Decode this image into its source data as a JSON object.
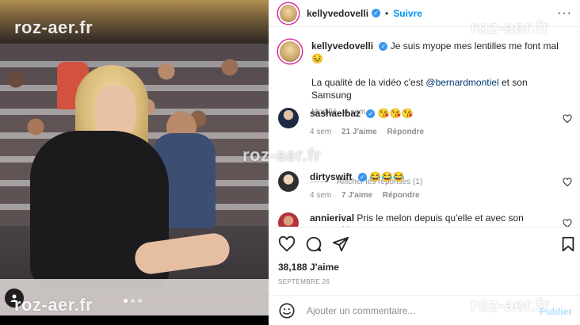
{
  "post": {
    "username": "kellyvedovelli",
    "follow_label": "Suivre",
    "separator": "•",
    "more_label": "···"
  },
  "caption": {
    "username": "kellyvedovelli",
    "line1": "Je suis myope mes lentilles me font mal 😣",
    "line2_prefix": "La qualité de la vidéo c'est ",
    "line2_mention": "@bernardmontiel",
    "line2_suffix": " et son Samsung",
    "meta": "Modifié · 4 sem"
  },
  "comments": [
    {
      "username": "sashaelbaz",
      "text": "😘😘😘",
      "time": "4 sem",
      "likes": "21 J'aime",
      "reply": "Répondre"
    },
    {
      "username": "dirtyswift",
      "text": "😂😂😂",
      "time": "4 sem",
      "likes": "7 J'aime",
      "reply": "Répondre"
    },
    {
      "username": "annierival",
      "text": "Pris le melon depuis qu'elle et avec son patron. Une"
    }
  ],
  "view_replies": "Afficher les réponses (1)",
  "likes": "38,188 J'aime",
  "date": "SEPTEMBRE 26",
  "add_comment": {
    "placeholder": "Ajouter un commentaire...",
    "publish": "Publier"
  },
  "watermarks": [
    "roz-aer.fr",
    "roz-aer.fr",
    "roz-aer.fr",
    "roz-aer.fr",
    "roz-aer.fr"
  ],
  "colors": {
    "accent": "#0095f6",
    "verified": "#3897f0",
    "mention": "#00376b",
    "muted": "#8e8e8e"
  }
}
